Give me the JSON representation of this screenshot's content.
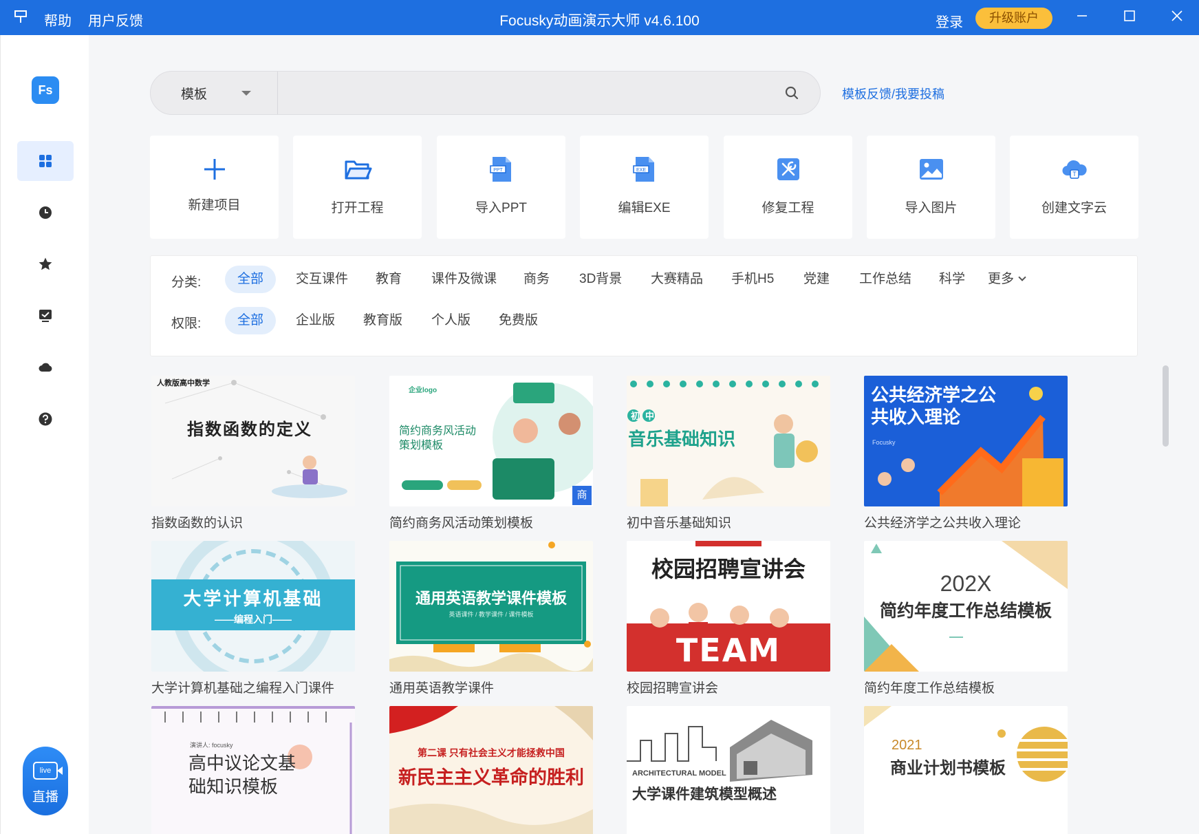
{
  "titlebar": {
    "app_icon": "pin-icon",
    "help": "帮助",
    "feedback": "用户反馈",
    "title": "Focusky动画演示大师 v4.6.100",
    "login": "登录",
    "upgrade": "升级账户",
    "accent": "#1e6fe0"
  },
  "sidebar": {
    "logo": "Fs",
    "items": [
      {
        "name": "templates",
        "icon": "grid-icon"
      },
      {
        "name": "recent",
        "icon": "clock-icon"
      },
      {
        "name": "favorites",
        "icon": "star-icon"
      },
      {
        "name": "presentation",
        "icon": "monitor-check-icon"
      },
      {
        "name": "cloud",
        "icon": "cloud-icon"
      },
      {
        "name": "help",
        "icon": "question-icon"
      }
    ],
    "live": {
      "badge": "live",
      "label": "直播"
    }
  },
  "search": {
    "scope": "模板",
    "placeholder": "",
    "feedback_link": "模板反馈/我要投稿"
  },
  "actions": [
    {
      "label": "新建项目",
      "icon": "plus-icon"
    },
    {
      "label": "打开工程",
      "icon": "folder-open-icon"
    },
    {
      "label": "导入PPT",
      "icon": "ppt-file-icon"
    },
    {
      "label": "编辑EXE",
      "icon": "exe-file-icon"
    },
    {
      "label": "修复工程",
      "icon": "repair-tools-icon"
    },
    {
      "label": "导入图片",
      "icon": "image-icon"
    },
    {
      "label": "创建文字云",
      "icon": "word-cloud-icon"
    }
  ],
  "filters": {
    "category_label": "分类:",
    "categories": [
      "全部",
      "交互课件",
      "教育",
      "课件及微课",
      "商务",
      "3D背景",
      "大赛精品",
      "手机H5",
      "党建",
      "工作总结",
      "科学",
      "更多"
    ],
    "category_selected": "全部",
    "permission_label": "权限:",
    "permissions": [
      "全部",
      "企业版",
      "教育版",
      "个人版",
      "免费版"
    ],
    "permission_selected": "全部"
  },
  "templates": [
    {
      "name": "指数函数的认识",
      "thumb_title": "指数函数的定义",
      "thumb_sub": "人教版高中数学"
    },
    {
      "name": "简约商务风活动策划模板",
      "thumb_title": "简约商务风活动策划模板",
      "thumb_sub": "企业logo",
      "badge": "商"
    },
    {
      "name": "初中音乐基础知识",
      "thumb_title": "音乐基础知识",
      "thumb_sub": "初中"
    },
    {
      "name": "公共经济学之公共收入理论",
      "thumb_title": "公共经济学之公共收入理论",
      "thumb_sub": "Focusky"
    },
    {
      "name": "大学计算机基础之编程入门课件",
      "thumb_title": "大学计算机基础",
      "thumb_sub": "——编程入门——"
    },
    {
      "name": "通用英语教学课件",
      "thumb_title": "通用英语教学课件模板",
      "thumb_sub": "英语课件 / 教学课件 / 课件模板"
    },
    {
      "name": "校园招聘宣讲会",
      "thumb_title": "校园招聘宣讲会",
      "thumb_sub": "TEAM"
    },
    {
      "name": "简约年度工作总结模板",
      "thumb_title": "简约年度工作总结模板",
      "thumb_sub": "202X"
    },
    {
      "name": "",
      "thumb_title": "高中议论文基础知识模板",
      "thumb_sub": "演讲人: focusky"
    },
    {
      "name": "",
      "thumb_title": "新民主主义革命的胜利",
      "thumb_sub": "第二课 只有社会主义才能拯救中国"
    },
    {
      "name": "",
      "thumb_title": "大学课件建筑模型概述",
      "thumb_sub": "ARCHITECTURAL MODEL"
    },
    {
      "name": "",
      "thumb_title": "商业计划书模板",
      "thumb_sub": "2021"
    }
  ]
}
